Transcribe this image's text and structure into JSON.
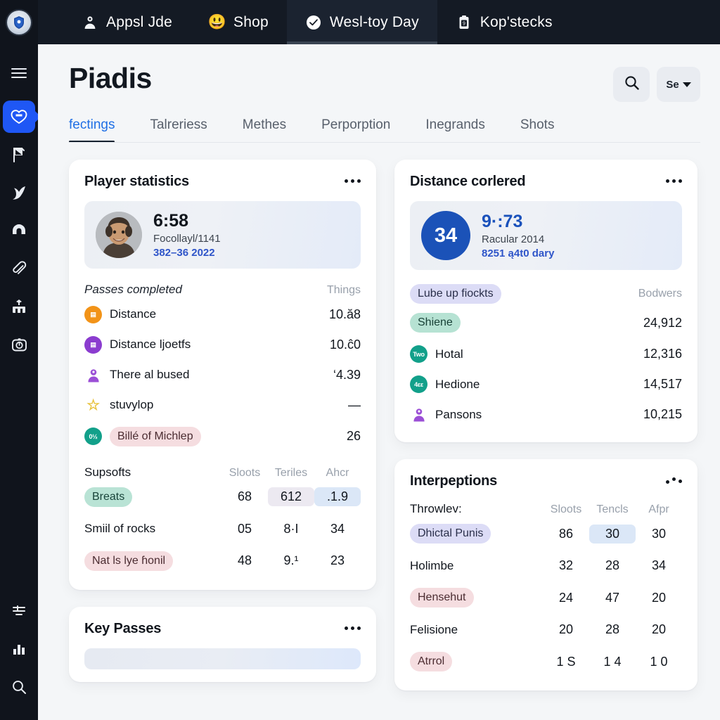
{
  "topbar": {
    "brand_icon": "shield-crest-logo",
    "items": [
      {
        "label": "Appsl Jde",
        "icon": "person-bust-icon",
        "active": false
      },
      {
        "label": "Shop",
        "icon": "grinning-face-emoji",
        "active": false
      },
      {
        "label": "Wesl-toy Day",
        "icon": "check-circle-icon",
        "active": true
      },
      {
        "label": "Kop'stecks",
        "icon": "clipboard-icon",
        "active": false
      }
    ]
  },
  "rail": {
    "items": [
      {
        "icon": "hamburger-menu-icon",
        "selected": false
      },
      {
        "icon": "heart-shield-icon",
        "selected": true
      },
      {
        "icon": "flag-pin-icon",
        "selected": false
      },
      {
        "icon": "bird-swoosh-icon",
        "selected": false
      },
      {
        "icon": "magnet-icon",
        "selected": false
      },
      {
        "icon": "paperclip-icon",
        "selected": false
      },
      {
        "icon": "podium-icon",
        "selected": false
      },
      {
        "icon": "stopwatch-icon",
        "selected": false
      }
    ],
    "bottom_items": [
      {
        "icon": "filter-lines-icon"
      },
      {
        "icon": "bar-chart-icon"
      },
      {
        "icon": "search-icon"
      }
    ]
  },
  "header": {
    "title": "Piadis",
    "search_icon": "search-icon",
    "select_label": "Se",
    "select_caret": "chevron-down-icon"
  },
  "tabs": [
    {
      "label": "fectings",
      "active": true
    },
    {
      "label": "Talreriess",
      "active": false
    },
    {
      "label": "Methes",
      "active": false
    },
    {
      "label": "Perporption",
      "active": false
    },
    {
      "label": "Inegrands",
      "active": false
    },
    {
      "label": "Shots",
      "active": false
    }
  ],
  "cards": {
    "player_statistics": {
      "title": "Player statistics",
      "menu_icon": "more-horizontal-icon",
      "hero": {
        "avatar": "player-portrait-photo",
        "main": "6:58",
        "sub": "Focollayl/1141",
        "link": "382–36  2022"
      },
      "section": {
        "label": "Passes completed",
        "right_label": "Things"
      },
      "rows": [
        {
          "badge": "orange",
          "badge_text": "▤",
          "name": "Distance",
          "value": "10.ă8"
        },
        {
          "badge": "purple",
          "badge_text": "▤",
          "name": "Distance ljoetfs",
          "value": "10.ĉ0"
        },
        {
          "badge": "fig",
          "badge_text": "",
          "name": "There al bused",
          "value": "‘4.39"
        }
      ],
      "starred": {
        "icon": "star-icon",
        "name": "stuvylop",
        "value": "—"
      },
      "tagged": {
        "badge": "teal",
        "badge_text": "0½",
        "pill": "Billé of Michlep",
        "value": "26"
      },
      "table": {
        "label": "Supsofts",
        "columns": [
          "Sloots",
          "Teriles",
          "Ahcr"
        ],
        "rows": [
          {
            "name": "Breats",
            "pill": "mint",
            "values": [
              "68",
              "612",
              ".1.9"
            ],
            "highlights": [
              "",
              "hl-lav",
              "hl-blue"
            ]
          },
          {
            "name": "Smiil of rocks",
            "pill": "",
            "values": [
              "05",
              "8·I",
              "34"
            ],
            "highlights": [
              "",
              "",
              ""
            ]
          },
          {
            "name": "Nat ls lye ɦonil",
            "pill": "rose",
            "values": [
              "48",
              "9.¹",
              "23"
            ],
            "highlights": [
              "",
              "",
              ""
            ]
          }
        ]
      }
    },
    "distance_corlered": {
      "title": "Distance corlered",
      "menu_icon": "more-horizontal-icon",
      "hero": {
        "circle_number": "34",
        "main": "9·:73",
        "sub": "Racular 2014",
        "link": "8251 ą4t0 dary"
      },
      "section": {
        "label": "Lube up fiockts",
        "right_label": "Bodwers"
      },
      "rows": [
        {
          "badge": "",
          "badge_text": "",
          "pill": "mint2",
          "name": "Shiene",
          "value": "24,912"
        },
        {
          "badge": "teal",
          "badge_text": "Two",
          "pill": "",
          "name": "Hotal",
          "value": "12,316"
        },
        {
          "badge": "teal",
          "badge_text": "4εε",
          "pill": "",
          "name": "Hedione",
          "value": "14,517"
        },
        {
          "badge": "fig",
          "badge_text": "",
          "pill": "",
          "name": "Pansons",
          "value": "10,215"
        }
      ]
    },
    "interpeptions": {
      "title": "Interpeptions",
      "menu_icon": "more-horizontal-icon",
      "table": {
        "label": "Throwlev:",
        "columns": [
          "Sloots",
          "Tencls",
          "Afpr"
        ],
        "rows": [
          {
            "name": "Dhictal Punis",
            "pill": "lav",
            "values": [
              "86",
              "30",
              "30"
            ],
            "highlights": [
              "",
              "hl-blue",
              ""
            ]
          },
          {
            "name": "Holimbe",
            "pill": "",
            "values": [
              "32",
              "28",
              "34"
            ],
            "highlights": [
              "",
              "",
              ""
            ]
          },
          {
            "name": "Hensehut",
            "pill": "rose",
            "values": [
              "24",
              "47",
              "20"
            ],
            "highlights": [
              "",
              "",
              ""
            ]
          },
          {
            "name": "Felisione",
            "pill": "",
            "values": [
              "20",
              "28",
              "20"
            ],
            "highlights": [
              "",
              "",
              ""
            ]
          },
          {
            "name": "Atrrol",
            "pill": "rose",
            "values": [
              "1 S",
              "1 4",
              "1 0"
            ],
            "highlights": [
              "",
              "",
              ""
            ]
          }
        ]
      }
    },
    "key_passes": {
      "title": "Key Passes",
      "menu_icon": "more-horizontal-icon"
    }
  },
  "colors": {
    "accent_blue": "#1f6fe5",
    "rail_bg": "#10141c",
    "topbar_bg": "#141a24",
    "page_bg": "#f4f6f8",
    "card_bg": "#ffffff",
    "selected_rail": "#1f57f5"
  }
}
